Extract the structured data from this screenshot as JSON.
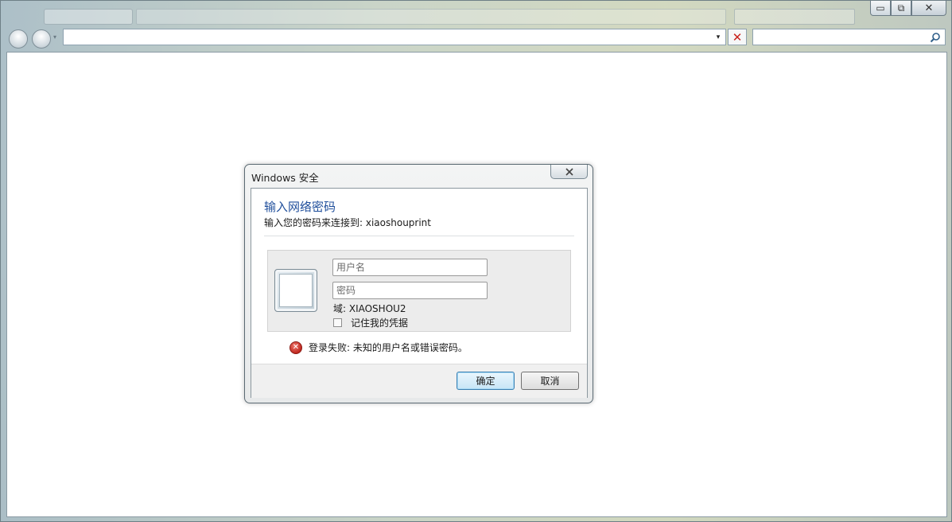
{
  "browser": {
    "window_buttons": {
      "minimize": "▭",
      "restore": "⧉",
      "close": "✕"
    },
    "nav": {
      "back_icon": "back-arrow",
      "forward_icon": "forward-arrow"
    },
    "address_value": "",
    "search_value": "",
    "stop_glyph": "✕",
    "dropdown_glyph": "▾"
  },
  "dialog": {
    "title": "Windows 安全",
    "close_glyph": "☒",
    "heading": "输入网络密码",
    "subheading": "输入您的密码来连接到: xiaoshouprint",
    "username_placeholder": "用户名",
    "password_placeholder": "密码",
    "domain_label": "域: XIAOSHOU2",
    "remember_label": "记住我的凭据",
    "remember_checked": false,
    "error_text": "登录失败: 未知的用户名或错误密码。",
    "ok_label": "确定",
    "cancel_label": "取消"
  },
  "colors": {
    "heading": "#1f4e9b",
    "error": "#c0281f",
    "stop": "#c8211b"
  }
}
